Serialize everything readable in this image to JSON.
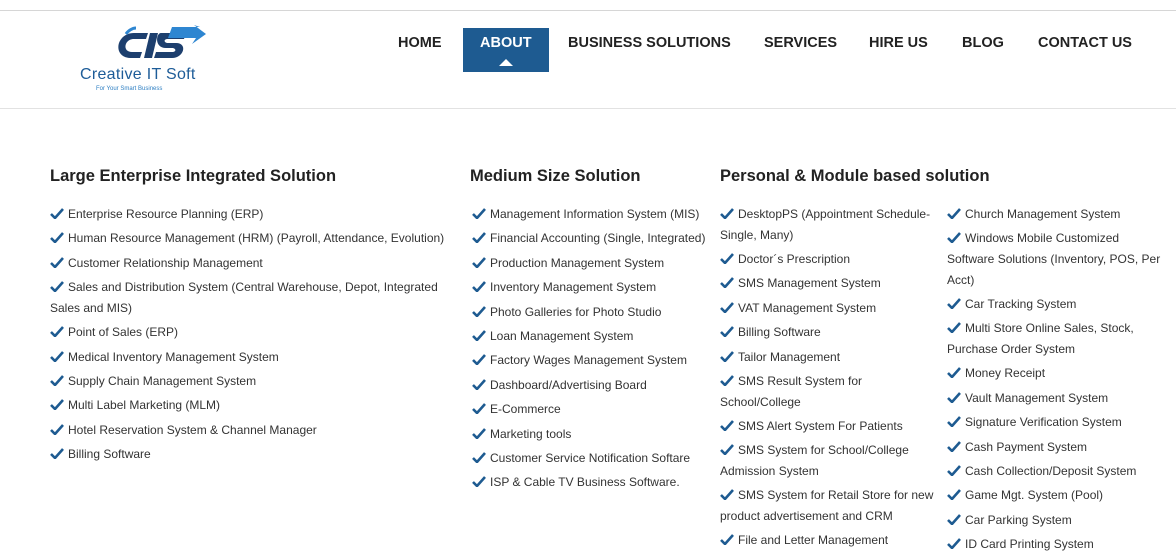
{
  "brand": {
    "name": "Creative IT Soft",
    "tagline": "For Your Smart Business",
    "colors": {
      "primary": "#1e5b91",
      "accent": "#2e7fc3",
      "text": "#333333"
    }
  },
  "nav": {
    "items": [
      {
        "label": "HOME",
        "active": false
      },
      {
        "label": "ABOUT",
        "active": true
      },
      {
        "label": "BUSINESS SOLUTIONS",
        "active": false
      },
      {
        "label": "SERVICES",
        "active": false
      },
      {
        "label": "HIRE US",
        "active": false
      },
      {
        "label": "BLOG",
        "active": false
      },
      {
        "label": "CONTACT US",
        "active": false
      }
    ]
  },
  "sections": {
    "large": {
      "title": "Large Enterprise Integrated Solution",
      "items": [
        "Enterprise Resource Planning (ERP)",
        "Human Resource Management (HRM) (Payroll, Attendance, Evolution)",
        "Customer Relationship Management",
        "Sales and Distribution System (Central Warehouse, Depot, Integrated",
        "Sales and MIS)",
        "Point of Sales (ERP)",
        "Medical Inventory Management System",
        "Supply Chain Management System",
        "Multi Label Marketing (MLM)",
        "Hotel Reservation System & Channel Manager",
        "Billing Software"
      ]
    },
    "medium": {
      "title": "Medium Size Solution",
      "items": [
        "Management Information System (MIS)",
        "Financial Accounting (Single, Integrated)",
        "Production Management System",
        "Inventory Management System",
        "Photo Galleries for Photo Studio",
        "Loan Management System",
        "Factory Wages Management System",
        "Dashboard/Advertising Board",
        "E-Commerce",
        "Marketing tools",
        "Customer Service Notification Softare",
        "ISP & Cable TV Business Software."
      ]
    },
    "personal": {
      "title": "Personal & Module based solution",
      "items_a": [
        "DesktopPS (Appointment Schedule-",
        "Single, Many)",
        "Doctor´s Prescription",
        "SMS Management System",
        "VAT Management System",
        "Billing Software",
        "Tailor Management",
        "SMS Result System for",
        "School/College",
        "SMS Alert System For Patients",
        "SMS System for School/College",
        "Admission System",
        "SMS System for Retail Store for new",
        "product advertisement and CRM",
        "File and Letter Management"
      ],
      "items_b": [
        "Church Management System",
        "Windows Mobile Customized",
        "Software Solutions (Inventory, POS, Per",
        "Acct)",
        "Car Tracking System",
        "Multi Store Online Sales, Stock,",
        "Purchase Order System",
        "Money Receipt",
        "Vault Management System",
        "Signature Verification System",
        "Cash Payment System",
        "Cash Collection/Deposit System",
        "Game Mgt. System (Pool)",
        "Car Parking System",
        "ID Card Printing System"
      ]
    }
  }
}
